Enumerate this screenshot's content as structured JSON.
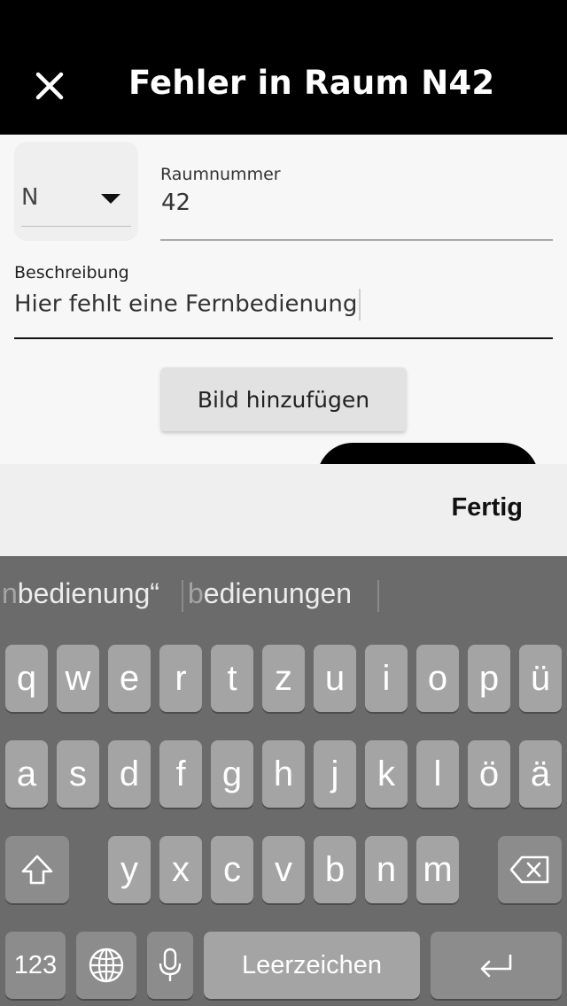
{
  "app_bar": {
    "title": "Fehler in Raum N42",
    "close_icon": "close-icon"
  },
  "form": {
    "building_select": {
      "value": "N",
      "icon": "caret-down-icon"
    },
    "room": {
      "label": "Raumnummer",
      "value": "42"
    },
    "description": {
      "label": "Beschreibung",
      "value": "Hier fehlt eine Fernbedienung"
    },
    "add_image_button": "Bild hinzufügen"
  },
  "accessory": {
    "done": "Fertig"
  },
  "keyboard": {
    "suggestions": [
      {
        "dim": "n",
        "text": "bedienung“"
      },
      {
        "dim": "b",
        "text": "edienungen"
      }
    ],
    "row1": [
      "q",
      "w",
      "e",
      "r",
      "t",
      "z",
      "u",
      "i",
      "o",
      "p",
      "ü"
    ],
    "row2": [
      "a",
      "s",
      "d",
      "f",
      "g",
      "h",
      "j",
      "k",
      "l",
      "ö",
      "ä"
    ],
    "row3": [
      "y",
      "x",
      "c",
      "v",
      "b",
      "n",
      "m"
    ],
    "numbers_key": "123",
    "space_key": "Leerzeichen",
    "icons": {
      "shift": "shift-icon",
      "backspace": "backspace-icon",
      "globe": "globe-icon",
      "mic": "microphone-icon",
      "return": "return-icon"
    }
  }
}
